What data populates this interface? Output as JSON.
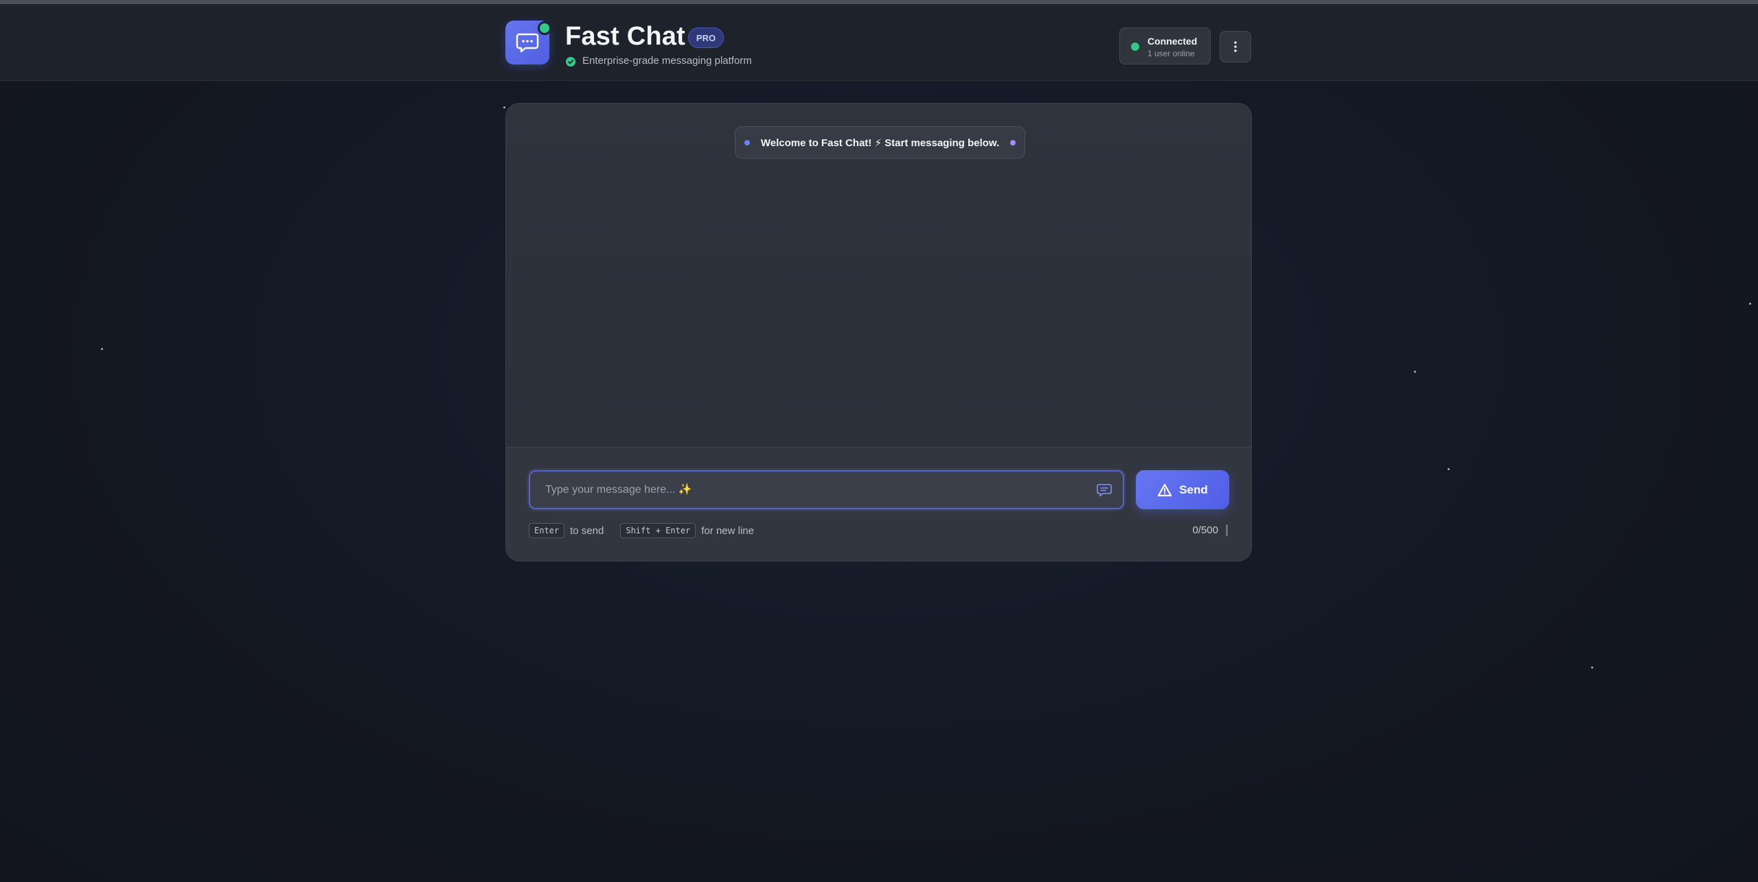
{
  "header": {
    "app_title": "Fast Chat",
    "badge": "PRO",
    "subtitle": "Enterprise-grade messaging platform",
    "status": {
      "title": "Connected",
      "subtitle": "1 user online",
      "color": "#34c98a"
    },
    "menu_icon": "kebab-menu-icon",
    "app_icon": "chat-bubble-icon"
  },
  "chat": {
    "welcome_message": "Welcome to Fast Chat! ⚡ Start messaging below.",
    "input": {
      "placeholder": "Type your message here... ✨",
      "value": ""
    },
    "send_label": "Send",
    "hints": {
      "send_key": "Enter",
      "send_text": "to send",
      "newline_key": "Shift + Enter",
      "newline_text": "for new line"
    },
    "char_count": "0/500"
  },
  "colors": {
    "accent": "#5865e6",
    "online": "#34c98a",
    "background": "#141824"
  }
}
